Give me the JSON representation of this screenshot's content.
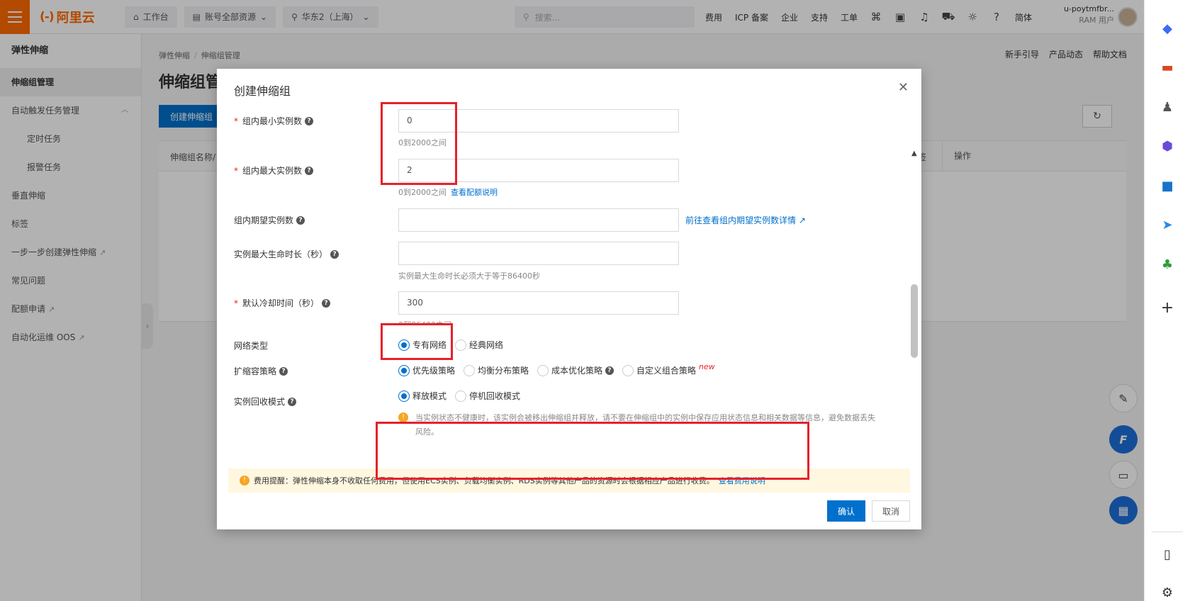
{
  "topbar": {
    "brand": "阿里云",
    "workbench": "工作台",
    "resources": "账号全部资源",
    "region": "华东2（上海）",
    "search_placeholder": "搜索...",
    "links": [
      "费用",
      "ICP 备案",
      "企业",
      "支持",
      "工单"
    ],
    "lang": "简体",
    "user_name": "u-poytmfbr...",
    "user_role": "RAM 用户"
  },
  "sidebar": {
    "title": "弹性伸缩",
    "items": [
      {
        "label": "伸缩组管理"
      },
      {
        "label": "自动触发任务管理"
      },
      {
        "label": "定时任务"
      },
      {
        "label": "报警任务"
      },
      {
        "label": "垂直伸缩"
      },
      {
        "label": "标签"
      },
      {
        "label": "一步一步创建弹性伸缩"
      },
      {
        "label": "常见问题"
      },
      {
        "label": "配额申请"
      },
      {
        "label": "自动化运维 OOS"
      }
    ]
  },
  "main": {
    "breadcrumb": [
      "弹性伸缩",
      "伸缩组管理"
    ],
    "help_links": [
      "新手引导",
      "产品动态",
      "帮助文档"
    ],
    "title": "伸缩组管",
    "create_button": "创建伸缩组",
    "columns": [
      "伸缩组名称/",
      "签",
      "操作"
    ]
  },
  "modal": {
    "title": "创建伸缩组",
    "min_label": "组内最小实例数",
    "min_value": "0",
    "min_hint": "0到2000之间",
    "max_label": "组内最大实例数",
    "max_value": "2",
    "max_hint": "0到2000之间",
    "max_hint_link": "查看配额说明",
    "desired_label": "组内期望实例数",
    "desired_value": "",
    "desired_link": "前往查看组内期望实例数详情",
    "lifetime_label": "实例最大生命时长（秒）",
    "lifetime_value": "",
    "lifetime_hint": "实例最大生命时长必须大于等于86400秒",
    "cooldown_label": "默认冷却时间（秒）",
    "cooldown_value": "300",
    "cooldown_hint": "0到86400之间",
    "network_label": "网络类型",
    "network_options": [
      "专有网络",
      "经典网络"
    ],
    "network_selected": "专有网络",
    "scaling_label": "扩缩容策略",
    "scaling_options": [
      "优先级策略",
      "均衡分布策略",
      "成本优化策略",
      "自定义组合策略"
    ],
    "scaling_new_tag": "new",
    "recycle_label": "实例回收模式",
    "recycle_options": [
      "释放模式",
      "停机回收模式"
    ],
    "recycle_warning": "当实例状态不健康时，该实例会被移出伸缩组并释放，请不要在伸缩组中的实例中保存应用状态信息和相关数据等信息，避免数据丢失风险。",
    "fee_notice": "费用提醒：弹性伸缩本身不收取任何费用，但使用ECS实例、负载均衡实例、RDS实例等其他产品的资源时会根据相应产品进行收费。",
    "fee_link": "查看费用说明",
    "ok": "确认",
    "cancel": "取消"
  },
  "colors": {
    "brand_orange": "#ff6a00",
    "primary_blue": "#0070cc",
    "highlight_red": "#e8202a",
    "warning_bg": "#fff7e0"
  }
}
